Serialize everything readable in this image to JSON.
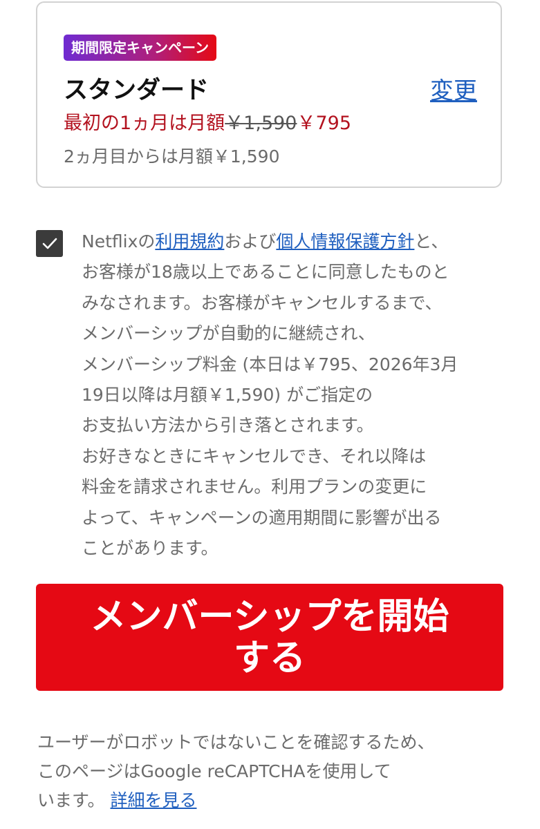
{
  "plan": {
    "badge": "期間限定キャンペーン",
    "name": "スタンダード",
    "change_link": "変更",
    "price_prefix": "最初の1ヵ月は月額",
    "old_price": "￥1,590",
    "new_price": "￥795",
    "renew_text": "2ヵ月目からは月額￥1,590"
  },
  "consent": {
    "checked": true,
    "line1_prefix": "Netflixの",
    "terms_link": "利用規約",
    "line1_mid": "および",
    "privacy_link": "個人情報保護方針",
    "line1_suffix": "と、",
    "lines": [
      "お客様が18歳以上であることに同意したものと",
      "みなされます。お客様がキャンセルするまで、",
      "メンバーシップが自動的に継続され、",
      "メンバーシップ料金 (本日は￥795、2026年3月",
      "19日以降は月額￥1,590) がご指定の",
      "お支払い方法から引き落とされます。",
      "お好きなときにキャンセルでき、それ以降は",
      "料金を請求されません。利用プランの変更に",
      "よって、キャンペーンの適用期間に影響が出る",
      "ことがあります。"
    ]
  },
  "start_button": {
    "line1": "メンバーシップを開始",
    "line2": "する"
  },
  "recaptcha": {
    "line1": "ユーザーがロボットではないことを確認するため、",
    "line2": "このページはGoogle reCAPTCHAを使用して",
    "line3_prefix": "います。",
    "learn_more_link": "詳細を見る"
  },
  "colors": {
    "brand_red": "#e50914",
    "price_red": "#b3121f",
    "link_blue": "#1f5fbf"
  }
}
